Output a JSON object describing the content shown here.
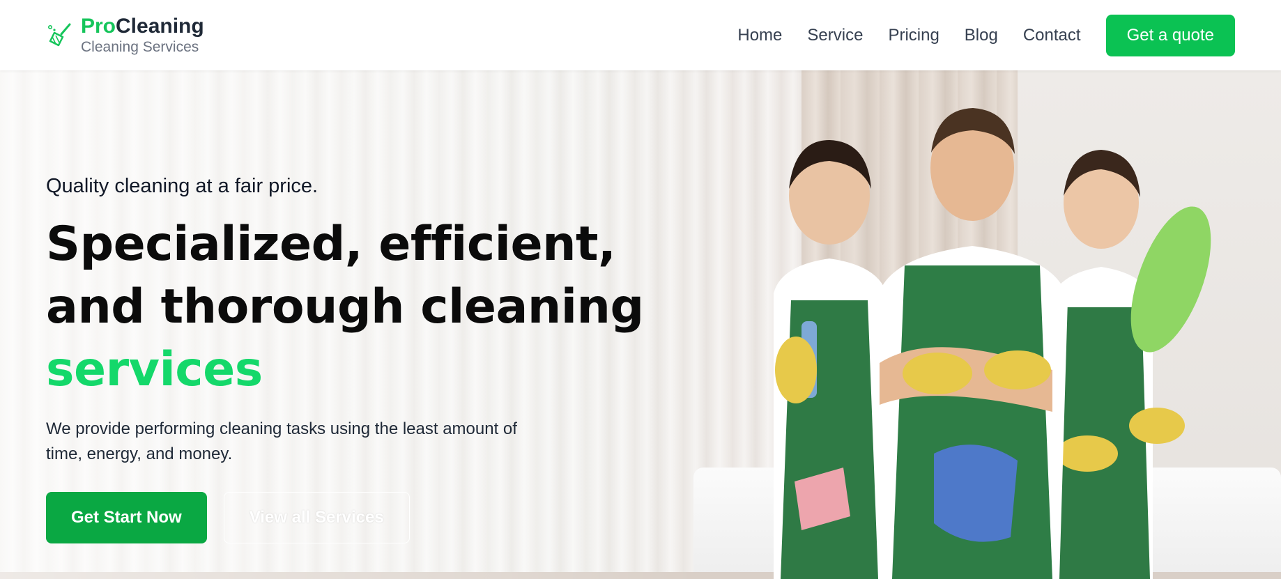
{
  "brand": {
    "name_accent": "Pro",
    "name_rest": "Cleaning",
    "tagline": "Cleaning Services",
    "icon": "broom-icon"
  },
  "nav": {
    "items": [
      "Home",
      "Service",
      "Pricing",
      "Blog",
      "Contact"
    ],
    "quote_button": "Get a quote"
  },
  "hero": {
    "eyebrow": "Quality cleaning at a fair price.",
    "headline_line1": "Specialized, efficient,",
    "headline_line2": "and thorough cleaning",
    "headline_accent": "services",
    "description": "We provide performing cleaning tasks using the least amount of time, energy, and money.",
    "primary_cta": "Get Start Now",
    "secondary_cta": "View all Services"
  },
  "colors": {
    "brand_green": "#16c55b",
    "button_green": "#0aa843",
    "accent_text": "#14d86a"
  }
}
